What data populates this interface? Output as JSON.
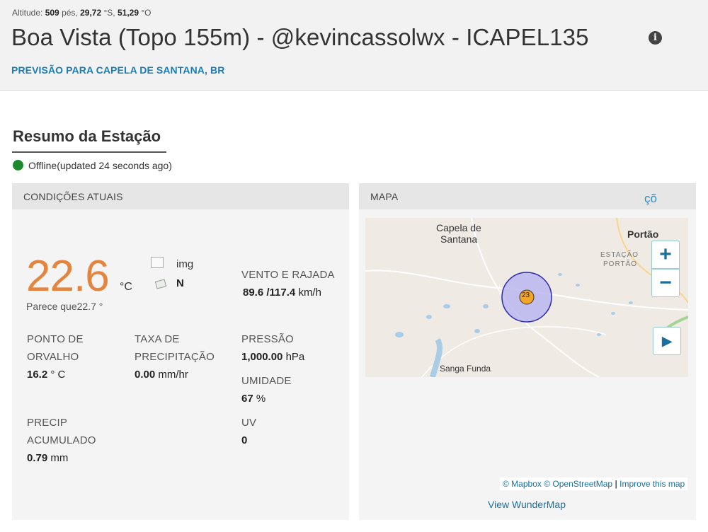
{
  "header": {
    "altitude_label": "Altitude:",
    "altitude_value": "509",
    "altitude_unit": "pés,",
    "lat": "29,72",
    "lat_dir": "°S,",
    "lon": "51,29",
    "lon_dir": "°O",
    "station_title": "Boa Vista (Topo 155m) - @kevincassolwx - ICAPEL135",
    "info_icon": "i",
    "forecast_link": "PREVISÃO PARA CAPELA DE SANTANA, BR"
  },
  "summary": {
    "title": "Resumo da Estação",
    "status_text": "Offline(updated 24 seconds ago)",
    "status_color": "#1e8a2e"
  },
  "conditions": {
    "panel_title": "CONDIÇÕES ATUAIS",
    "temperature": "22.6",
    "temp_unit": "°C",
    "feels_like_label": "Parece que",
    "feels_like_value": "22.7 °",
    "img_label": "img",
    "wind_direction": "N",
    "wind_label": "VENTO E RAJADA",
    "wind_speed": "89.6",
    "wind_gust": "/117.4",
    "wind_unit": "km/h",
    "dew_point_label_1": "PONTO DE",
    "dew_point_label_2": "ORVALHO",
    "dew_point_value": "16.2",
    "dew_point_unit": "° C",
    "precip_rate_label_1": "TAXA DE",
    "precip_rate_label_2": "PRECIPITAÇÃO",
    "precip_rate_value": "0.00",
    "precip_rate_unit": "mm/hr",
    "pressure_label": "PRESSÃO",
    "pressure_value": "1,000.00",
    "pressure_unit": "hPa",
    "humidity_label": "UMIDADE",
    "humidity_value": "67",
    "humidity_unit": "%",
    "precip_accum_label_1": "PRECIP",
    "precip_accum_label_2": "ACUMULADO",
    "precip_accum_value": "0.79",
    "precip_accum_unit": "mm",
    "uv_label": "UV",
    "uv_value": "0",
    "temp_color": "#e3843f"
  },
  "map": {
    "panel_title": "MAPA",
    "cog_icon": "çõ",
    "place_capela_1": "Capela de",
    "place_capela_2": "Santana",
    "place_portao": "Portão",
    "place_estacao_1": "ESTAÇÃO",
    "place_estacao_2": "PORTÃO",
    "place_sanga": "Sanga Funda",
    "marker_value": "23",
    "zoom_in": "+",
    "zoom_out": "−",
    "play": "▶",
    "attribution_mapbox": "© Mapbox",
    "attribution_osm": "© OpenStreetMap",
    "attribution_sep": "|",
    "attribution_improve": "Improve this map",
    "view_link": "View WunderMap"
  }
}
